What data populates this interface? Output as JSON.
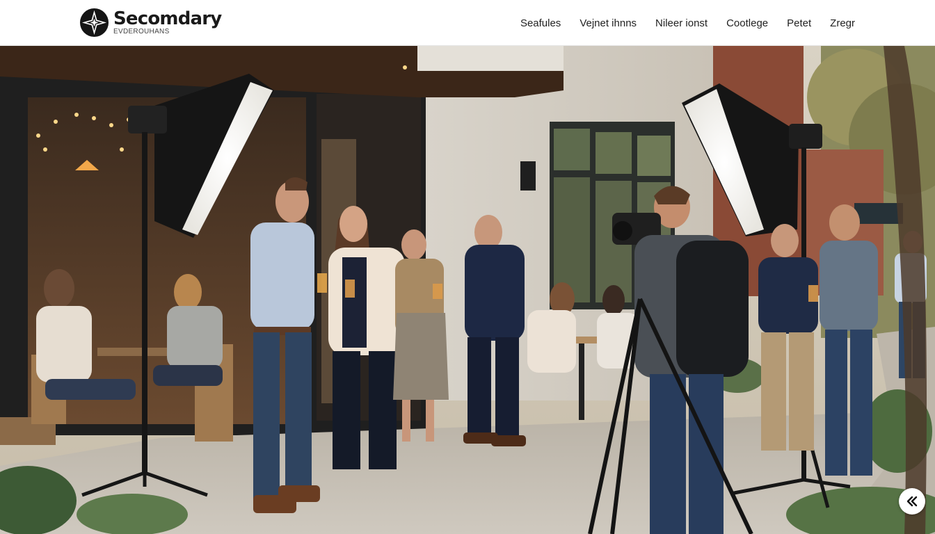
{
  "brand": {
    "name": "Secomdary",
    "tagline": "EVDEROUHANS",
    "logo_icon": "compass-star-icon"
  },
  "nav": {
    "items": [
      {
        "label": "Seafules"
      },
      {
        "label": "Vejnet ihnns"
      },
      {
        "label": "Nileer ionst"
      },
      {
        "label": "Cootlege"
      },
      {
        "label": "Petet"
      },
      {
        "label": "Zregr"
      }
    ]
  },
  "hero": {
    "image_subject": "photo-shoot-outdoor-cafe"
  },
  "fab": {
    "icon": "double-chevron-left-icon"
  }
}
